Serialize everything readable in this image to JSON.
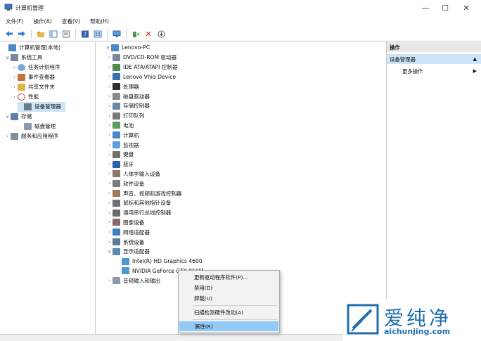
{
  "window": {
    "title": "计算机管理",
    "controls": {
      "minimize": "—",
      "maximize": "☐",
      "close": "✕"
    }
  },
  "menu": [
    "文件(F)",
    "操作(A)",
    "查看(V)",
    "帮助(H)"
  ],
  "toolbar": {
    "icons": [
      "back-arrow-icon",
      "forward-arrow-icon",
      "up-folder-icon",
      "show-tree-icon",
      "properties-icon",
      "help-icon",
      "view-icon",
      "monitor-icon",
      "update-driver-icon",
      "uninstall-x-icon",
      "disable-icon"
    ]
  },
  "left_tree": [
    {
      "label": "计算机管理(本地)",
      "arrow": "",
      "icon": "computer-icon"
    },
    {
      "label": "系统工具",
      "arrow": "∨",
      "icon": "tools-icon"
    },
    {
      "label": "任务计划程序",
      "arrow": "›",
      "icon": "clock-icon"
    },
    {
      "label": "事件查看器",
      "arrow": "›",
      "icon": "event-icon"
    },
    {
      "label": "共享文件夹",
      "arrow": "›",
      "icon": "share-folder-icon"
    },
    {
      "label": "性能",
      "arrow": "›",
      "icon": "performance-icon"
    },
    {
      "label": "设备管理器",
      "arrow": "",
      "icon": "device-manager-icon"
    },
    {
      "label": "存储",
      "arrow": "∨",
      "icon": "storage-icon"
    },
    {
      "label": "磁盘管理",
      "arrow": "",
      "icon": "disk-icon"
    },
    {
      "label": "服务和应用程序",
      "arrow": "›",
      "icon": "services-icon"
    }
  ],
  "device_tree": {
    "root": "Lenovo-PC",
    "categories": [
      {
        "label": "DVD/CD-ROM 驱动器",
        "icon": "dvd-icon"
      },
      {
        "label": "IDE ATA/ATAPI 控制器",
        "icon": "ide-icon"
      },
      {
        "label": "Lenovo Vhid Device",
        "icon": "lenovo-device-icon"
      },
      {
        "label": "处理器",
        "icon": "processor-icon"
      },
      {
        "label": "磁盘驱动器",
        "icon": "disk-drive-icon"
      },
      {
        "label": "存储控制器",
        "icon": "storage-controller-icon"
      },
      {
        "label": "打印队列",
        "icon": "printer-icon"
      },
      {
        "label": "电池",
        "icon": "battery-icon"
      },
      {
        "label": "计算机",
        "icon": "computer-icon"
      },
      {
        "label": "监视器",
        "icon": "monitor-icon"
      },
      {
        "label": "键盘",
        "icon": "keyboard-icon"
      },
      {
        "label": "蓝牙",
        "icon": "bluetooth-icon"
      },
      {
        "label": "人体学输入设备",
        "icon": "hid-icon"
      },
      {
        "label": "软件设备",
        "icon": "software-device-icon"
      },
      {
        "label": "声音、视频和游戏控制器",
        "icon": "sound-icon"
      },
      {
        "label": "鼠标和其他指针设备",
        "icon": "mouse-icon"
      },
      {
        "label": "通用串行总线控制器",
        "icon": "usb-icon"
      },
      {
        "label": "图像设备",
        "icon": "camera-icon"
      },
      {
        "label": "网络适配器",
        "icon": "network-icon"
      },
      {
        "label": "系统设备",
        "icon": "system-device-icon"
      },
      {
        "label": "显示适配器",
        "icon": "display-adapter-icon"
      }
    ],
    "display_children": [
      "Intel(R) HD Graphics 4600",
      "NVIDIA GeForce GTX 850M"
    ],
    "after_display": "音频输入和输出"
  },
  "actions": {
    "header": "操作",
    "device_manager": "设备管理器",
    "more": "更多操作"
  },
  "context_menu": {
    "update_driver": "更新驱动程序软件(P)...",
    "disable": "禁用(D)",
    "uninstall": "卸载(U)",
    "scan": "扫描检测硬件改动(A)",
    "properties": "属性(R)"
  },
  "watermark": {
    "brand_cn": "爱纯净",
    "url": "aichunjing.com"
  },
  "colors": {
    "selection": "#cce4f7",
    "menu_highlight": "#91c9f7",
    "brand": "#1f6fae"
  }
}
